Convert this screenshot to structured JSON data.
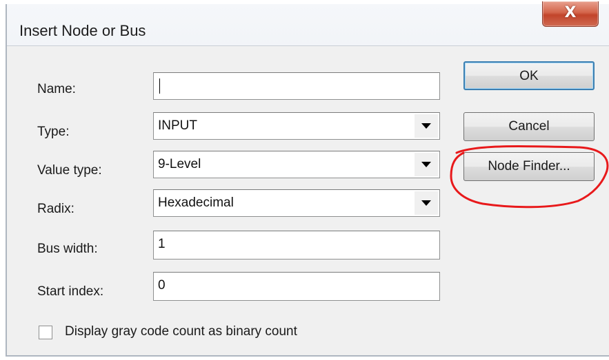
{
  "window": {
    "title": "Insert Node or Bus",
    "close_glyph": "X"
  },
  "form": {
    "name": {
      "label": "Name:",
      "value": ""
    },
    "type": {
      "label": "Type:",
      "value": "INPUT"
    },
    "value_type": {
      "label": "Value type:",
      "value": "9-Level"
    },
    "radix": {
      "label": "Radix:",
      "value": "Hexadecimal"
    },
    "bus_width": {
      "label": "Bus width:",
      "value": "1"
    },
    "start_index": {
      "label": "Start index:",
      "value": "0"
    },
    "gray_code": {
      "label": "Display gray code count as binary count",
      "checked": false
    }
  },
  "buttons": {
    "ok": "OK",
    "cancel": "Cancel",
    "node_finder": "Node Finder..."
  },
  "colors": {
    "annotation": "#e8191b",
    "default_button_border": "#3c7fb1"
  },
  "icons": {
    "close": "close-icon",
    "dropdown": "chevron-down-icon",
    "checkbox": "checkbox-icon"
  }
}
